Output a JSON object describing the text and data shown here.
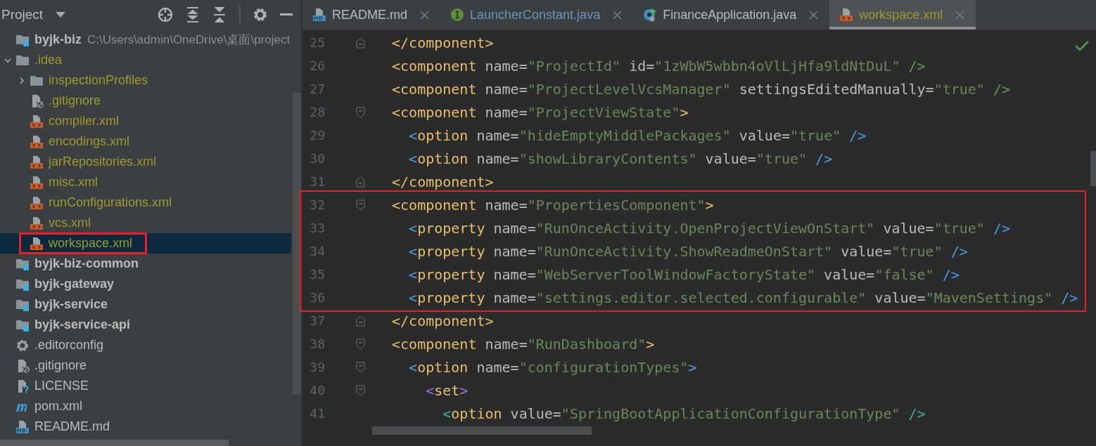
{
  "project_panel": {
    "title": "Project",
    "tree": [
      {
        "label": "byjk-biz",
        "path": "C:\\Users\\admin\\OneDrive\\桌面\\project",
        "kind": "module",
        "color": "#bbbbbb",
        "selected": false,
        "children": [
          {
            "label": ".idea",
            "kind": "folder",
            "color": "#9b9b2f",
            "expanded": true,
            "selected": false,
            "children": [
              {
                "label": "inspectionProfiles",
                "kind": "folder",
                "color": "#9b9b2f",
                "expanded": false,
                "selected": false
              },
              {
                "label": ".gitignore",
                "kind": "ignore",
                "color": "#9b9b2f",
                "selected": false
              },
              {
                "label": "compiler.xml",
                "kind": "xml",
                "color": "#9b9b2f",
                "selected": false
              },
              {
                "label": "encodings.xml",
                "kind": "xml",
                "color": "#9b9b2f",
                "selected": false
              },
              {
                "label": "jarRepositories.xml",
                "kind": "xml",
                "color": "#9b9b2f",
                "selected": false
              },
              {
                "label": "misc.xml",
                "kind": "xml",
                "color": "#9b9b2f",
                "selected": false
              },
              {
                "label": "runConfigurations.xml",
                "kind": "xml",
                "color": "#9b9b2f",
                "selected": false
              },
              {
                "label": "vcs.xml",
                "kind": "xml",
                "color": "#9b9b2f",
                "selected": false
              },
              {
                "label": "workspace.xml",
                "kind": "xml",
                "color": "#9b9b2f",
                "selected": true,
                "boxed": true
              }
            ]
          },
          {
            "label": "byjk-biz-common",
            "kind": "module",
            "color": "#bbbbbb",
            "selected": false
          },
          {
            "label": "byjk-gateway",
            "kind": "module",
            "color": "#bbbbbb",
            "selected": false
          },
          {
            "label": "byjk-service",
            "kind": "module",
            "color": "#bbbbbb",
            "selected": false
          },
          {
            "label": "byjk-service-api",
            "kind": "module",
            "color": "#bbbbbb",
            "selected": false
          },
          {
            "label": ".editorconfig",
            "kind": "config",
            "color": "#bbbbbb",
            "selected": false
          },
          {
            "label": ".gitignore",
            "kind": "ignore",
            "color": "#bbbbbb",
            "selected": false
          },
          {
            "label": "LICENSE",
            "kind": "unknown",
            "color": "#bbbbbb",
            "selected": false
          },
          {
            "label": "pom.xml",
            "kind": "maven",
            "color": "#bbbbbb",
            "selected": false
          },
          {
            "label": "README.md",
            "kind": "markdown",
            "color": "#bbbbbb",
            "selected": false
          }
        ]
      }
    ]
  },
  "tabs": [
    {
      "label": "README.md",
      "kind": "markdown",
      "color": "#bbbbbb",
      "selected": false
    },
    {
      "label": "LauncherConstant.java",
      "kind": "interface",
      "color": "#6897bb",
      "selected": false
    },
    {
      "label": "FinanceApplication.java",
      "kind": "spring",
      "color": "#bbbbbb",
      "selected": false
    },
    {
      "label": "workspace.xml",
      "kind": "xml",
      "color": "#9b9b2f",
      "selected": true
    }
  ],
  "editor": {
    "lines": [
      {
        "number": "25",
        "kind": "fold-end",
        "boxed": false,
        "tokens": [
          {
            "kind": "b",
            "t": "</",
            "color": "#e8bf6a"
          },
          {
            "kind": "tag",
            "t": "component"
          },
          {
            "kind": "b",
            "t": ">",
            "color": "#e8bf6a"
          }
        ]
      },
      {
        "number": "26",
        "kind": "plain",
        "boxed": false,
        "tokens": [
          {
            "kind": "b",
            "t": "<",
            "color": "#e8bf6a"
          },
          {
            "kind": "tag",
            "t": "component"
          },
          {
            "kind": "attr",
            "t": " name"
          },
          {
            "kind": "eq",
            "t": "="
          },
          {
            "kind": "str",
            "t": "\"ProjectId\""
          },
          {
            "kind": "attr",
            "t": " id"
          },
          {
            "kind": "eq",
            "t": "="
          },
          {
            "kind": "str",
            "t": "\"1zWbW5wbbn4oVlLjHfa9ldNtDuL\""
          },
          {
            "kind": "b",
            "t": " />",
            "color": "#5f9e4a"
          }
        ]
      },
      {
        "number": "27",
        "kind": "plain",
        "boxed": false,
        "tokens": [
          {
            "kind": "b",
            "t": "<",
            "color": "#e8bf6a"
          },
          {
            "kind": "tag",
            "t": "component"
          },
          {
            "kind": "attr",
            "t": " name"
          },
          {
            "kind": "eq",
            "t": "="
          },
          {
            "kind": "str",
            "t": "\"ProjectLevelVcsManager\""
          },
          {
            "kind": "attr",
            "t": " settingsEditedManually"
          },
          {
            "kind": "eq",
            "t": "="
          },
          {
            "kind": "str",
            "t": "\"true\""
          },
          {
            "kind": "b",
            "t": " />",
            "color": "#5f9e4a"
          }
        ]
      },
      {
        "number": "28",
        "kind": "fold-start",
        "boxed": false,
        "tokens": [
          {
            "kind": "b",
            "t": "<",
            "color": "#e8bf6a"
          },
          {
            "kind": "tag",
            "t": "component"
          },
          {
            "kind": "attr",
            "t": " name"
          },
          {
            "kind": "eq",
            "t": "="
          },
          {
            "kind": "str",
            "t": "\"ProjectViewState\""
          },
          {
            "kind": "b",
            "t": ">",
            "color": "#e8bf6a"
          }
        ]
      },
      {
        "number": "29",
        "kind": "plain",
        "boxed": false,
        "tokens": [
          {
            "kind": "b",
            "t": "  <",
            "color": "#4a9ce8"
          },
          {
            "kind": "tag",
            "t": "option"
          },
          {
            "kind": "attr",
            "t": " name"
          },
          {
            "kind": "eq",
            "t": "="
          },
          {
            "kind": "str",
            "t": "\"hideEmptyMiddlePackages\""
          },
          {
            "kind": "attr",
            "t": " value"
          },
          {
            "kind": "eq",
            "t": "="
          },
          {
            "kind": "str",
            "t": "\"true\""
          },
          {
            "kind": "b",
            "t": " />",
            "color": "#4a9ce8"
          }
        ]
      },
      {
        "number": "30",
        "kind": "plain",
        "boxed": false,
        "tokens": [
          {
            "kind": "b",
            "t": "  <",
            "color": "#4a9ce8"
          },
          {
            "kind": "tag",
            "t": "option"
          },
          {
            "kind": "attr",
            "t": " name"
          },
          {
            "kind": "eq",
            "t": "="
          },
          {
            "kind": "str",
            "t": "\"showLibraryContents\""
          },
          {
            "kind": "attr",
            "t": " value"
          },
          {
            "kind": "eq",
            "t": "="
          },
          {
            "kind": "str",
            "t": "\"true\""
          },
          {
            "kind": "b",
            "t": " />",
            "color": "#4a9ce8"
          }
        ]
      },
      {
        "number": "31",
        "kind": "fold-end",
        "boxed": false,
        "tokens": [
          {
            "kind": "b",
            "t": "</",
            "color": "#e8bf6a"
          },
          {
            "kind": "tag",
            "t": "component"
          },
          {
            "kind": "b",
            "t": ">",
            "color": "#e8bf6a"
          }
        ]
      },
      {
        "number": "32",
        "kind": "fold-start",
        "boxed": true,
        "tokens": [
          {
            "kind": "b",
            "t": "<",
            "color": "#e8bf6a"
          },
          {
            "kind": "tag",
            "t": "component"
          },
          {
            "kind": "attr",
            "t": " name"
          },
          {
            "kind": "eq",
            "t": "="
          },
          {
            "kind": "str",
            "t": "\"PropertiesComponent\""
          },
          {
            "kind": "b",
            "t": ">",
            "color": "#e8bf6a"
          }
        ]
      },
      {
        "number": "33",
        "kind": "plain",
        "boxed": true,
        "tokens": [
          {
            "kind": "b",
            "t": "  <",
            "color": "#4a9ce8"
          },
          {
            "kind": "tag",
            "t": "property"
          },
          {
            "kind": "attr",
            "t": " name"
          },
          {
            "kind": "eq",
            "t": "="
          },
          {
            "kind": "str",
            "t": "\"RunOnceActivity.OpenProjectViewOnStart\""
          },
          {
            "kind": "attr",
            "t": " value"
          },
          {
            "kind": "eq",
            "t": "="
          },
          {
            "kind": "str",
            "t": "\"true\""
          },
          {
            "kind": "b",
            "t": " />",
            "color": "#4a9ce8"
          }
        ]
      },
      {
        "number": "34",
        "kind": "plain",
        "boxed": true,
        "tokens": [
          {
            "kind": "b",
            "t": "  <",
            "color": "#4a9ce8"
          },
          {
            "kind": "tag",
            "t": "property"
          },
          {
            "kind": "attr",
            "t": " name"
          },
          {
            "kind": "eq",
            "t": "="
          },
          {
            "kind": "str",
            "t": "\"RunOnceActivity.ShowReadmeOnStart\""
          },
          {
            "kind": "attr",
            "t": " value"
          },
          {
            "kind": "eq",
            "t": "="
          },
          {
            "kind": "str",
            "t": "\"true\""
          },
          {
            "kind": "b",
            "t": " />",
            "color": "#4a9ce8"
          }
        ]
      },
      {
        "number": "35",
        "kind": "plain",
        "boxed": true,
        "tokens": [
          {
            "kind": "b",
            "t": "  <",
            "color": "#4a9ce8"
          },
          {
            "kind": "tag",
            "t": "property"
          },
          {
            "kind": "attr",
            "t": " name"
          },
          {
            "kind": "eq",
            "t": "="
          },
          {
            "kind": "str",
            "t": "\"WebServerToolWindowFactoryState\""
          },
          {
            "kind": "attr",
            "t": " value"
          },
          {
            "kind": "eq",
            "t": "="
          },
          {
            "kind": "str",
            "t": "\"false\""
          },
          {
            "kind": "b",
            "t": " />",
            "color": "#4a9ce8"
          }
        ]
      },
      {
        "number": "36",
        "kind": "plain",
        "boxed": true,
        "tokens": [
          {
            "kind": "b",
            "t": "  <",
            "color": "#4a9ce8"
          },
          {
            "kind": "tag",
            "t": "property"
          },
          {
            "kind": "attr",
            "t": " name"
          },
          {
            "kind": "eq",
            "t": "="
          },
          {
            "kind": "str",
            "t": "\"settings.editor.selected.configurable\""
          },
          {
            "kind": "attr",
            "t": " value"
          },
          {
            "kind": "eq",
            "t": "="
          },
          {
            "kind": "str",
            "t": "\"MavenSettings\""
          },
          {
            "kind": "b",
            "t": " />",
            "color": "#4a9ce8"
          }
        ]
      },
      {
        "number": "37",
        "kind": "fold-end",
        "boxed": false,
        "tokens": [
          {
            "kind": "b",
            "t": "</",
            "color": "#e8bf6a"
          },
          {
            "kind": "tag",
            "t": "component"
          },
          {
            "kind": "b",
            "t": ">",
            "color": "#e8bf6a"
          }
        ]
      },
      {
        "number": "38",
        "kind": "fold-start",
        "boxed": false,
        "tokens": [
          {
            "kind": "b",
            "t": "<",
            "color": "#e8bf6a"
          },
          {
            "kind": "tag",
            "t": "component"
          },
          {
            "kind": "attr",
            "t": " name"
          },
          {
            "kind": "eq",
            "t": "="
          },
          {
            "kind": "str",
            "t": "\"RunDashboard\""
          },
          {
            "kind": "b",
            "t": ">",
            "color": "#e8bf6a"
          }
        ]
      },
      {
        "number": "39",
        "kind": "fold-start",
        "boxed": false,
        "tokens": [
          {
            "kind": "b",
            "t": "  <",
            "color": "#4a9ce8"
          },
          {
            "kind": "tag",
            "t": "option"
          },
          {
            "kind": "attr",
            "t": " name"
          },
          {
            "kind": "eq",
            "t": "="
          },
          {
            "kind": "str",
            "t": "\"configurationTypes\""
          },
          {
            "kind": "b",
            "t": ">",
            "color": "#4a9ce8"
          }
        ]
      },
      {
        "number": "40",
        "kind": "fold-start",
        "boxed": false,
        "tokens": [
          {
            "kind": "b",
            "t": "    <",
            "color": "#9876e0"
          },
          {
            "kind": "tag",
            "t": "set"
          },
          {
            "kind": "b",
            "t": ">",
            "color": "#9876e0"
          }
        ]
      },
      {
        "number": "41",
        "kind": "plain",
        "boxed": false,
        "tokens": [
          {
            "kind": "b",
            "t": "      <",
            "color": "#3fb0a0"
          },
          {
            "kind": "tag",
            "t": "option"
          },
          {
            "kind": "attr",
            "t": " value"
          },
          {
            "kind": "eq",
            "t": "="
          },
          {
            "kind": "str",
            "t": "\"SpringBootApplicationConfigurationType\""
          },
          {
            "kind": "b",
            "t": " />",
            "color": "#3fb0a0"
          }
        ]
      }
    ]
  }
}
